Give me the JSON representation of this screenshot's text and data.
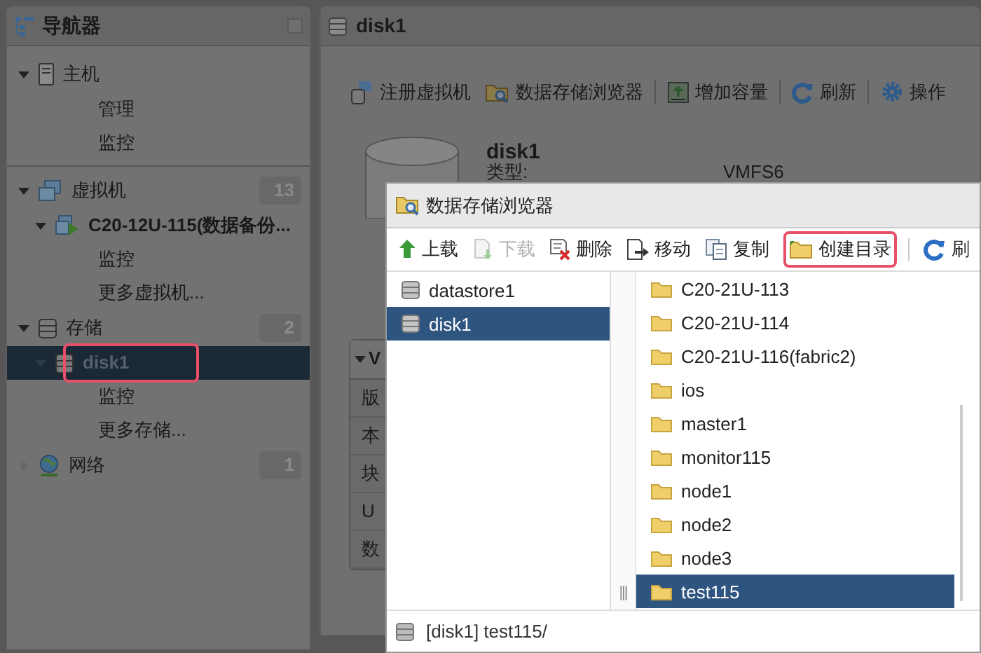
{
  "navigator": {
    "title": "导航器",
    "sections": [
      {
        "label": "主机",
        "expanded": true,
        "children": [
          {
            "label": "管理",
            "selected": false,
            "annotated": false
          },
          {
            "label": "监控",
            "selected": false,
            "annotated": false
          }
        ]
      },
      {
        "label": "虚拟机",
        "badge": "13",
        "expanded": true,
        "children": [
          {
            "label": "C20-12U-115(数据备份...",
            "expanded": true,
            "selected": false,
            "annotated": false,
            "children": [
              {
                "label": "监控",
                "selected": false,
                "annotated": false
              }
            ]
          },
          {
            "label": "更多虚拟机...",
            "selected": false,
            "annotated": false
          }
        ]
      },
      {
        "label": "存储",
        "badge": "2",
        "expanded": true,
        "children": [
          {
            "label": "disk1",
            "expanded": true,
            "selected": true,
            "annotated": true,
            "children": [
              {
                "label": "监控",
                "selected": false,
                "annotated": false
              }
            ]
          },
          {
            "label": "更多存储...",
            "selected": false,
            "annotated": false
          }
        ]
      },
      {
        "label": "网络",
        "badge": "1",
        "expanded": false
      }
    ]
  },
  "main": {
    "title": "disk1",
    "toolbar": [
      "注册虚拟机",
      "数据存储浏览器",
      "增加容量",
      "刷新",
      "操作"
    ],
    "heading": "disk1",
    "type_label": "类型:",
    "type_value": "VMFS6",
    "section_title": "V",
    "section_rows": [
      "版",
      "本",
      "块",
      "U",
      "数"
    ]
  },
  "dialog": {
    "title": "数据存储浏览器",
    "toolbar": [
      {
        "label": "上载",
        "disabled": false,
        "annotated": false
      },
      {
        "label": "下载",
        "disabled": true,
        "annotated": false
      },
      {
        "label": "删除",
        "disabled": false,
        "annotated": false
      },
      {
        "label": "移动",
        "disabled": false,
        "annotated": false
      },
      {
        "label": "复制",
        "disabled": false,
        "annotated": false
      },
      {
        "label": "创建目录",
        "disabled": false,
        "annotated": true
      },
      {
        "label": "刷",
        "disabled": false,
        "annotated": false
      }
    ],
    "datastores": [
      {
        "name": "datastore1",
        "selected": false
      },
      {
        "name": "disk1",
        "selected": true
      }
    ],
    "splitter": "|||",
    "folders": [
      {
        "name": "C20-21U-113",
        "selected": false
      },
      {
        "name": "C20-21U-114",
        "selected": false
      },
      {
        "name": "C20-21U-116(fabric2)",
        "selected": false
      },
      {
        "name": "ios",
        "selected": false
      },
      {
        "name": "master1",
        "selected": false
      },
      {
        "name": "monitor115",
        "selected": false
      },
      {
        "name": "node1",
        "selected": false
      },
      {
        "name": "node2",
        "selected": false
      },
      {
        "name": "node3",
        "selected": false
      },
      {
        "name": "test115",
        "selected": true
      }
    ],
    "path": "[disk1] test115/"
  }
}
